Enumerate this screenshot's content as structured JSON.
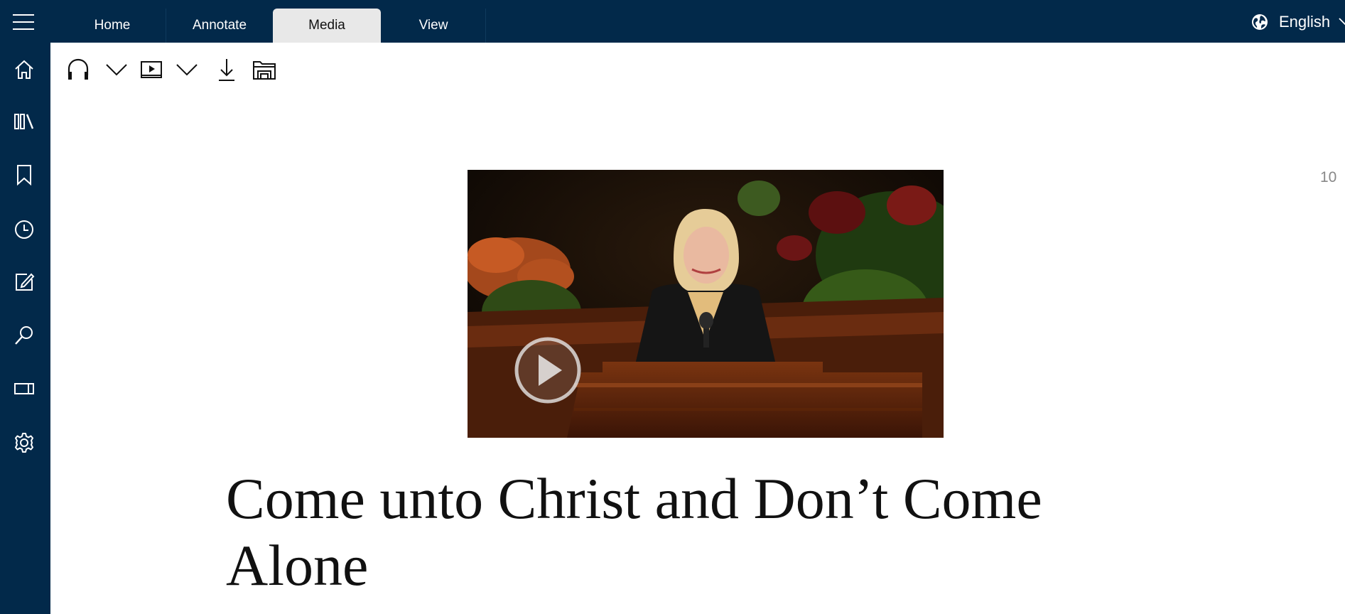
{
  "app": {
    "tabs": [
      {
        "label": "Home"
      },
      {
        "label": "Annotate"
      },
      {
        "label": "Media"
      },
      {
        "label": "View"
      }
    ],
    "active_tab": "Media",
    "language": "English"
  },
  "sidebar": {
    "items": [
      {
        "icon": "home-icon"
      },
      {
        "icon": "library-icon"
      },
      {
        "icon": "bookmark-icon"
      },
      {
        "icon": "history-icon"
      },
      {
        "icon": "notes-icon"
      },
      {
        "icon": "search-icon"
      },
      {
        "icon": "panel-icon"
      },
      {
        "icon": "settings-icon"
      }
    ]
  },
  "toolbar": {
    "items": [
      "headphones-icon",
      "audio-options-chevron",
      "video-icon",
      "video-options-chevron",
      "download-icon",
      "manage-downloads-icon"
    ]
  },
  "content": {
    "title": "Come unto Christ and Don’t Come Alone",
    "page_number": "10"
  },
  "colors": {
    "nav_background": "#02294a",
    "active_tab": "#e8e8e8"
  }
}
